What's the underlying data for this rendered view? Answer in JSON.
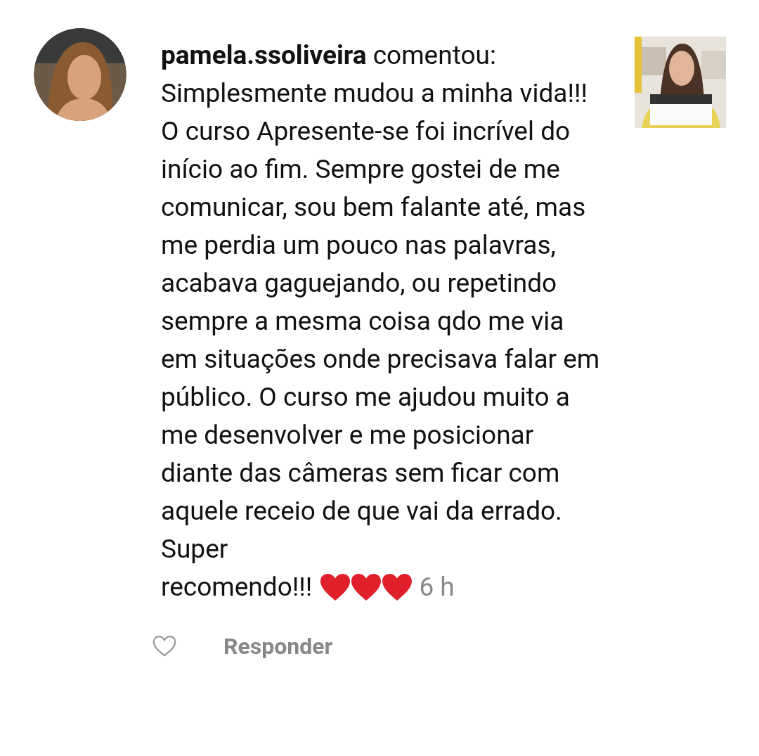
{
  "comment": {
    "username": "pamela.ssoliveira",
    "verb": "comentou:",
    "text": "Simplesmente mudou a minha vida!!! O curso Apresente-se foi incrível do início ao fim. Sempre gostei de me comunicar, sou bem falante até, mas me perdia um pouco nas palavras, acabava gaguejando, ou repetindo sempre a mesma coisa qdo me via em situações onde precisava falar em público. O curso me ajudou muito a me desenvolver e me posicionar diante das câmeras sem ficar com aquele receio de que vai da errado. Super",
    "text_end": "recomendo!!!",
    "time": "6 h",
    "liked": false,
    "reply": "Responder"
  }
}
